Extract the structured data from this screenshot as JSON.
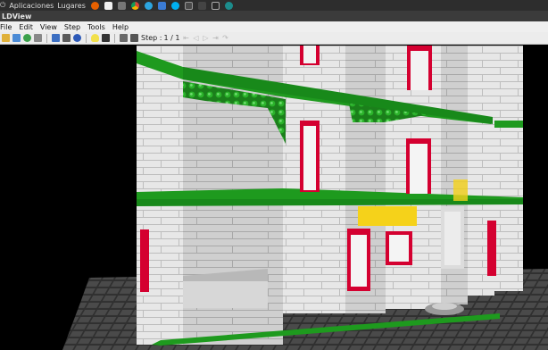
{
  "system_panel": {
    "menu": [
      "Aplicaciones",
      "Lugares"
    ],
    "icons": [
      "power-icon",
      "firefox-icon",
      "file-icon",
      "mail-icon",
      "chrome-icon",
      "telegram-icon",
      "email-client-icon",
      "skype-icon",
      "terminal-icon",
      "settings-icon",
      "monitor-icon",
      "network-icon"
    ]
  },
  "window": {
    "title": "LDView"
  },
  "menubar": {
    "items": [
      "File",
      "Edit",
      "View",
      "Step",
      "Tools",
      "Help"
    ]
  },
  "toolbar": {
    "step_label": "Step :",
    "step_value": "1 / 1",
    "icons": [
      "open-icon",
      "save-icon",
      "reload-icon",
      "camera-icon",
      "view-icon",
      "render-icon",
      "color-icon",
      "lightbulb-icon",
      "textures-icon",
      "axis-icon",
      "spin-icon"
    ],
    "nav": [
      "first-step",
      "previous-step",
      "next-step",
      "last-step",
      "goto-step"
    ]
  },
  "colors": {
    "brick_white": "#e6e6e6",
    "brick_red": "#d40030",
    "brick_green": "#1e9a1e",
    "brick_yellow": "#f5d21a",
    "baseplate": "#3c3c3c"
  }
}
